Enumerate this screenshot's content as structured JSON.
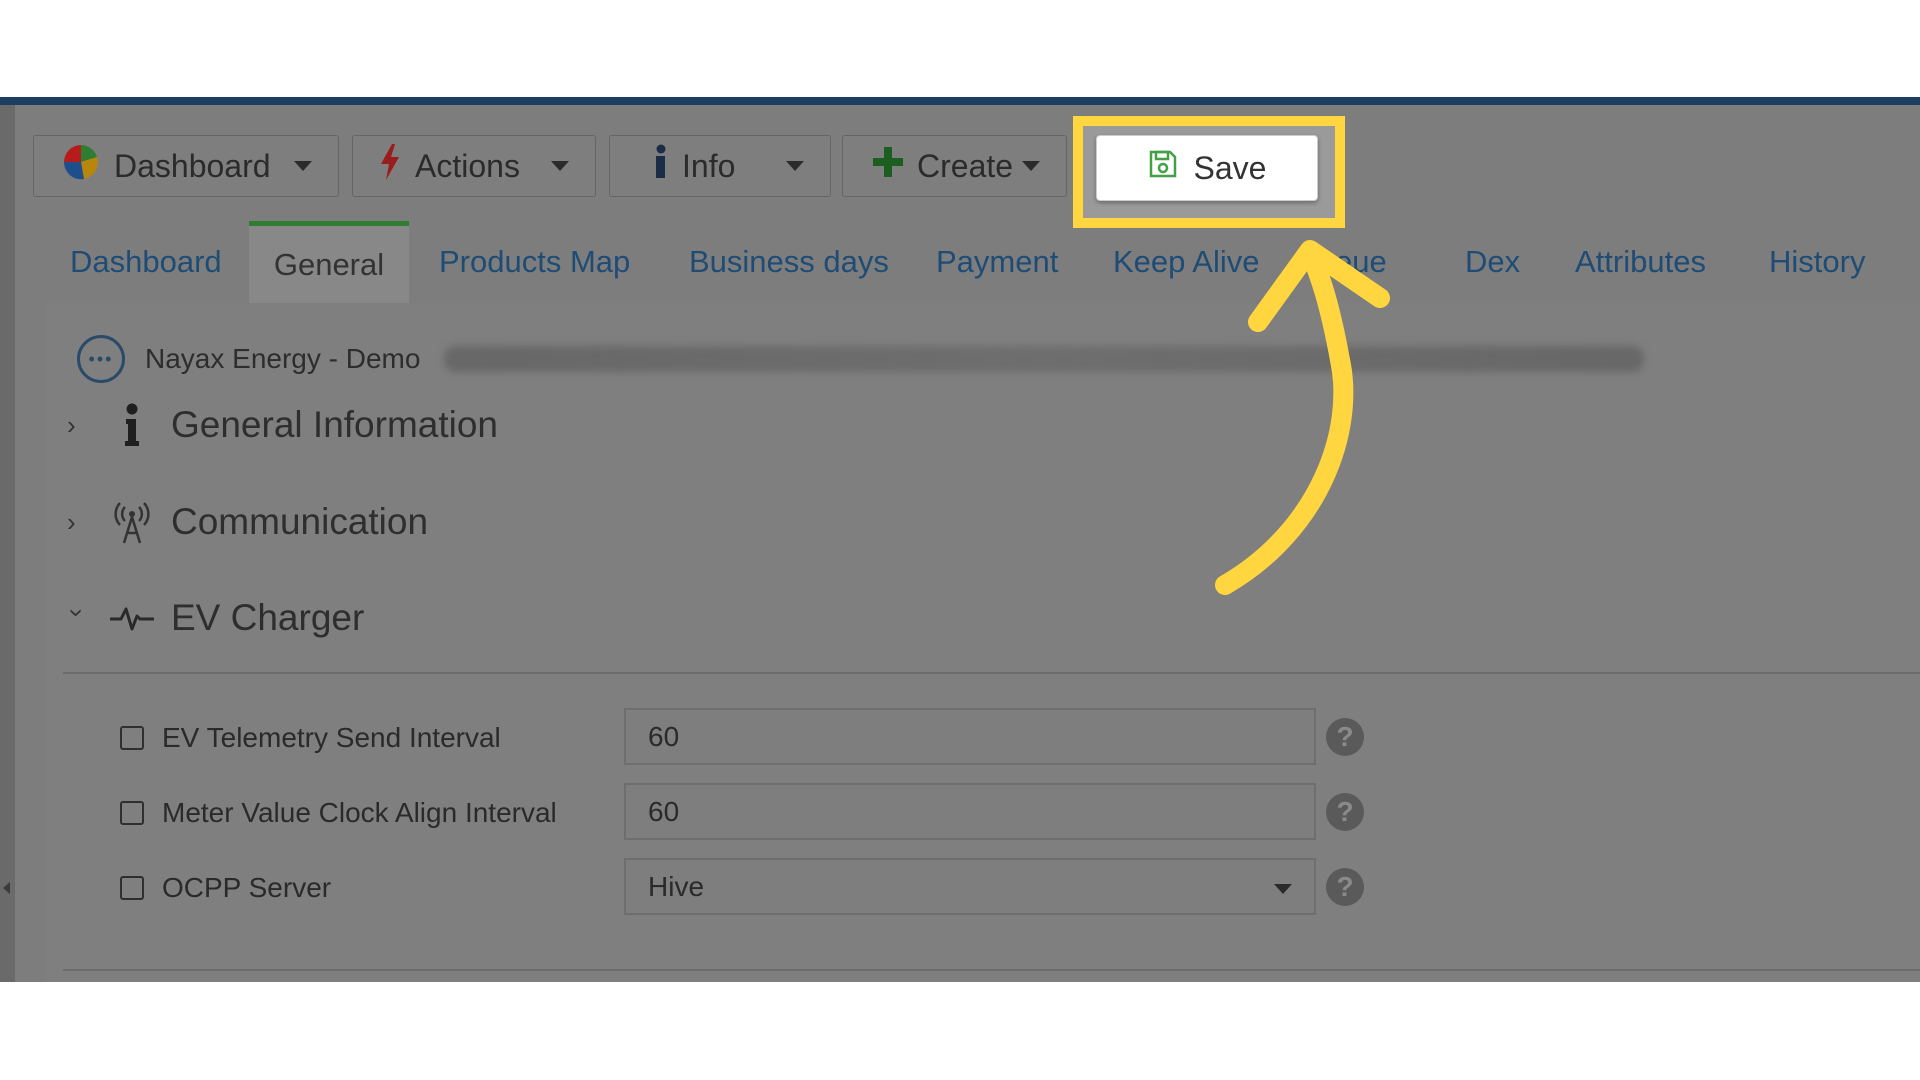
{
  "colors": {
    "accent_highlight": "#ffd63f",
    "tab_link": "#1f4c75",
    "active_tab_border": "#2e7d32",
    "top_bar": "#1d3f5f",
    "save_icon": "#43a047"
  },
  "toolbar": {
    "dashboard": {
      "label": "Dashboard",
      "icon": "pie-chart-icon"
    },
    "actions": {
      "label": "Actions",
      "icon": "lightning-icon"
    },
    "info": {
      "label": "Info",
      "icon": "info-icon"
    },
    "create": {
      "label": "Create",
      "icon": "plus-icon"
    },
    "save": {
      "label": "Save",
      "icon": "floppy-disk-icon"
    }
  },
  "tabs": [
    {
      "label": "Dashboard",
      "active": false
    },
    {
      "label": "General",
      "active": true
    },
    {
      "label": "Products Map",
      "active": false
    },
    {
      "label": "Business days",
      "active": false
    },
    {
      "label": "Payment",
      "active": false
    },
    {
      "label": "Keep Alive",
      "active": false
    },
    {
      "label": "eue",
      "active": false
    },
    {
      "label": "Dex",
      "active": false
    },
    {
      "label": "Attributes",
      "active": false
    },
    {
      "label": "History",
      "active": false
    }
  ],
  "breadcrumb": {
    "name": "Nayax Energy - Demo",
    "icon": "more-dots-icon"
  },
  "sections": [
    {
      "title": "General Information",
      "icon": "info-icon",
      "expanded": false
    },
    {
      "title": "Communication",
      "icon": "antenna-icon",
      "expanded": false
    },
    {
      "title": "EV Charger",
      "icon": "pulse-icon",
      "expanded": true
    }
  ],
  "fields": [
    {
      "label": "EV Telemetry Send Interval",
      "value": "60",
      "type": "text",
      "checked": false
    },
    {
      "label": "Meter Value Clock Align Interval",
      "value": "60",
      "type": "text",
      "checked": false
    },
    {
      "label": "OCPP Server",
      "value": "Hive",
      "type": "select",
      "checked": false
    }
  ]
}
